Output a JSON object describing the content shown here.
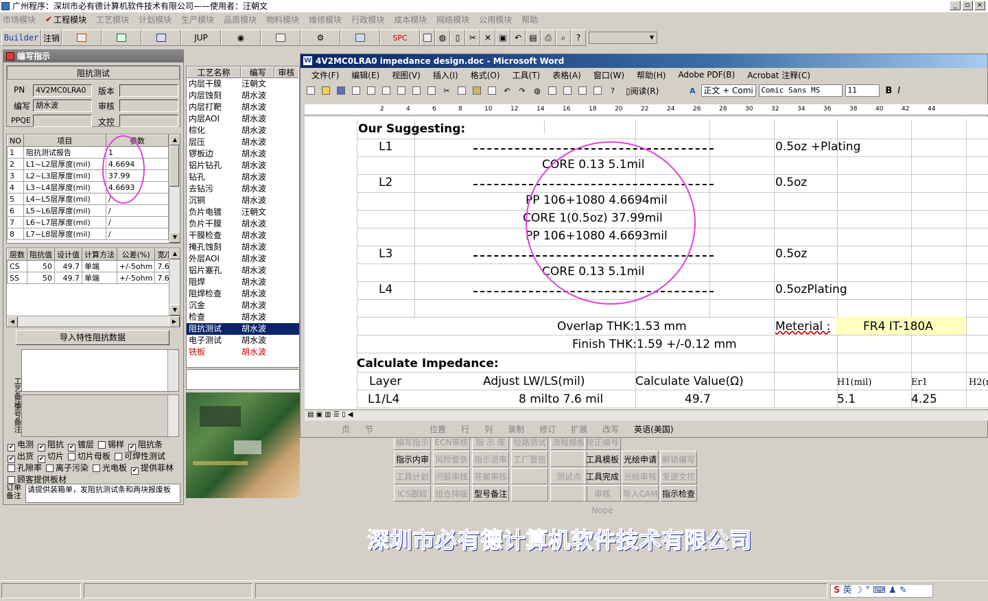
{
  "app": {
    "title": "广州程序：深圳市必有德计算机软件技术有限公司——使用者：汪朝文"
  },
  "menu": [
    "市场模块",
    "工程模块",
    "工艺模块",
    "计划模块",
    "生产模块",
    "品质模块",
    "物料模块",
    "维修模块",
    "行政模块",
    "成本模块",
    "网络模块",
    "公用模块",
    "帮助"
  ],
  "toolbar": {
    "builder": "Builder",
    "logout": "注销",
    "jup": "JUP",
    "spc": "SPC"
  },
  "panel": {
    "title": "编写指示",
    "group": "阻抗测试",
    "pn_label": "PN",
    "pn_value": "4V2MC0LRA0",
    "version_label": "版本",
    "writer_label": "编写",
    "writer_value": "胡水波",
    "review_label": "审核",
    "ppqe_label": "PPQE",
    "doc_label": "文控"
  },
  "param_table": {
    "headers": [
      "NO",
      "项目",
      "参数"
    ],
    "rows": [
      [
        "1",
        "阻抗测试报告",
        "1"
      ],
      [
        "2",
        "L1~L2层厚度(mil)",
        "4.6694"
      ],
      [
        "3",
        "L2~L3层厚度(mil)",
        "37.99"
      ],
      [
        "4",
        "L3~L4层厚度(mil)",
        "4.6693"
      ],
      [
        "5",
        "L4~L5层厚度(mil)",
        "/"
      ],
      [
        "6",
        "L5~L6层厚度(mil)",
        "/"
      ],
      [
        "7",
        "L6~L7层厚度(mil)",
        "/"
      ],
      [
        "8",
        "L7~L8层厚度(mil)",
        "/"
      ]
    ]
  },
  "imp_table": {
    "headers": [
      "层数",
      "阻抗值",
      "设计值",
      "计算方法",
      "公差(%)",
      "宽/距"
    ],
    "rows": [
      [
        "CS",
        "50",
        "49.7",
        "单端",
        "+/-5ohm",
        "7.6"
      ],
      [
        "SS",
        "50",
        "49.7",
        "单端",
        "+/-5ohm",
        "7.6"
      ]
    ]
  },
  "import_button": "导入特性阻抗数据",
  "craft_note_label": "工艺备注",
  "model_note_label": "型号备注",
  "checkboxes": [
    {
      "label": "电测",
      "checked": true
    },
    {
      "label": "阻抗",
      "checked": true
    },
    {
      "label": "镀层",
      "checked": true
    },
    {
      "label": "锡样",
      "checked": false
    },
    {
      "label": "阻抗条",
      "checked": true
    },
    {
      "label": "出货",
      "checked": true
    },
    {
      "label": "切片",
      "checked": true
    },
    {
      "label": "切片母板",
      "checked": false
    },
    {
      "label": "可焊性测试",
      "checked": false
    },
    {
      "label": "孔隙率",
      "checked": false
    },
    {
      "label": "离子污染",
      "checked": false
    },
    {
      "label": "光电板",
      "checked": false
    },
    {
      "label": "提供菲林",
      "checked": true
    },
    {
      "label": "顾客提供板材",
      "checked": false
    }
  ],
  "order_note_label": "订单备注",
  "order_note_value": "请提供装箱单，发阻抗测试条和两块报废板",
  "process_list": {
    "headers": [
      "工艺名称",
      "编写",
      "审核"
    ],
    "rows": [
      [
        "内层干膜",
        "汪朝文"
      ],
      [
        "内层蚀刻",
        "胡水波"
      ],
      [
        "内层打靶",
        "胡水波"
      ],
      [
        "内层AOI",
        "胡水波"
      ],
      [
        "棕化",
        "胡水波"
      ],
      [
        "层压",
        "胡水波"
      ],
      [
        "锣板边",
        "胡水波"
      ],
      [
        "铝片钻孔",
        "胡水波"
      ],
      [
        "钻孔",
        "胡水波"
      ],
      [
        "去钻污",
        "胡水波"
      ],
      [
        "沉铜",
        "胡水波"
      ],
      [
        "负片电镀",
        "汪朝文"
      ],
      [
        "负片干膜",
        "胡水波"
      ],
      [
        "干膜检查",
        "胡水波"
      ],
      [
        "掩孔蚀刻",
        "胡水波"
      ],
      [
        "外层AOI",
        "胡水波"
      ],
      [
        "铝片塞孔",
        "胡水波"
      ],
      [
        "阻焊",
        "胡水波"
      ],
      [
        "阻焊检查",
        "胡水波"
      ],
      [
        "沉金",
        "胡水波"
      ],
      [
        "检查",
        "胡水波"
      ],
      [
        "阻抗测试",
        "胡水波"
      ],
      [
        "电子测试",
        "胡水波"
      ],
      [
        "铣板",
        "胡水波"
      ]
    ]
  },
  "modules": [
    [
      "编写指示",
      "ECN审核",
      "指 示 库",
      "短路测试",
      "流程模板",
      "修正编号"
    ],
    [
      "指示内审",
      "风险警告",
      "指示退审",
      "工厂警告",
      "",
      "工具模板",
      "光绘申请",
      "解锁编写"
    ],
    [
      "工具计划",
      "问题审核",
      "答案审核",
      "",
      "测试点",
      "工具完成",
      "光绘审核",
      "发送文控"
    ],
    [
      "ICS跟踪",
      "组合排版",
      "型号备注",
      "",
      "",
      "审核Nope",
      "导入CAM",
      "指示检查"
    ]
  ],
  "word": {
    "title": "4V2MC0LRA0 impedance design.doc - Microsoft Word",
    "menu": [
      "文件(F)",
      "编辑(E)",
      "视图(V)",
      "插入(I)",
      "格式(O)",
      "工具(T)",
      "表格(A)",
      "窗口(W)",
      "帮助(H)",
      "Adobe PDF(B)",
      "Acrobat 注释(C)"
    ],
    "read_btn": "阅读(R)",
    "style": "正文 + Comi",
    "font": "Comic Sans MS",
    "size": "11",
    "ruler": [
      "2",
      "4",
      "6",
      "8",
      "10",
      "12",
      "14",
      "16",
      "18",
      "20",
      "22",
      "24",
      "26",
      "28",
      "30",
      "32",
      "34",
      "36",
      "38",
      "40",
      "42",
      "44"
    ],
    "doc": {
      "heading1": "Our Suggesting:",
      "l1": "L1",
      "l1_right": "0.5oz +Plating",
      "core1": "CORE  0.13  5.1mil",
      "l2": "L2",
      "l2_right": "0.5oz",
      "pp1": "PP  106+1080  4.6694mil",
      "core2": "CORE  1(0.5oz)  37.99mil",
      "pp2": "PP  106+1080  4.6693mil",
      "l3": "L3",
      "l3_right": "0.5oz",
      "core3": "CORE  0.13  5.1mil",
      "l4": "L4",
      "l4_right": "0.5ozPlating",
      "overlap": "Overlap THK:1.53 mm",
      "material_label": "Meterial :",
      "material_value": "FR4 IT-180A",
      "finish": "Finish THK:1.59 +/-0.12 mm",
      "heading2": "Calculate Impedance:",
      "col_layer": "Layer",
      "col_adjust": "Adjust LW/LS(mil)",
      "col_calc": "Calculate Value(Ω)",
      "col_h1": "H1(mil)",
      "col_er1": "Er1",
      "col_h2": "H2(m",
      "row_layer": "L1/L4",
      "row_adjust": "8 milto  7.6 mil",
      "row_calc": "49.7",
      "row_h1": "5.1",
      "row_er1": "4.25"
    },
    "status": [
      "页",
      "节",
      "位置",
      "行",
      "列",
      "录制",
      "修订",
      "扩展",
      "改写",
      "英语(美国)"
    ]
  },
  "company": "深圳市必有德计算机软件技术有限公司",
  "tray": {
    "ime": "英"
  },
  "colors": {
    "highlight": "#e040e0",
    "selection": "#0a246a",
    "word_title": "#0a246a",
    "company": "#3050d0"
  }
}
